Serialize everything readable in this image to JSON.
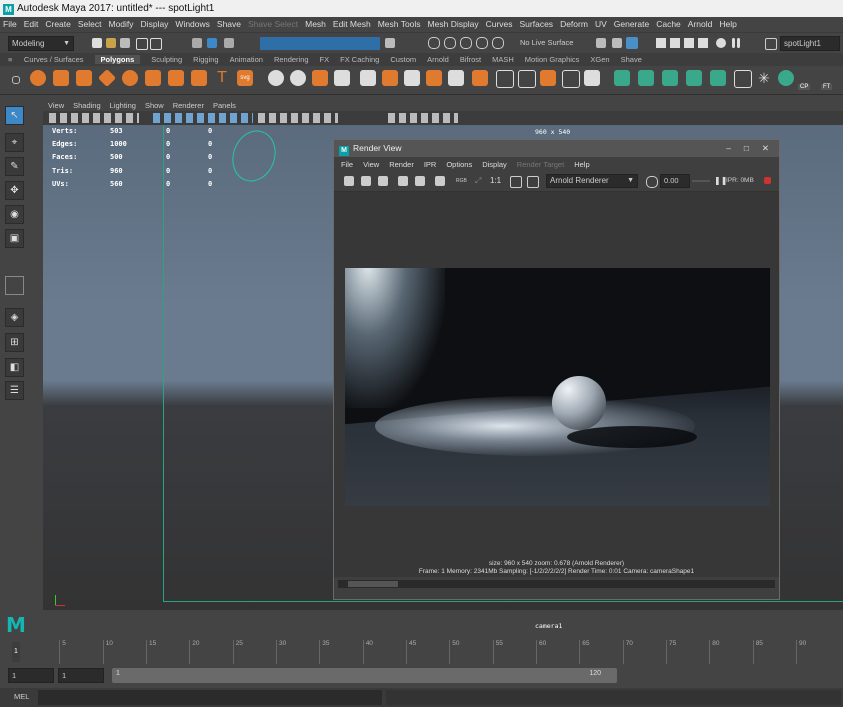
{
  "window": {
    "title": "Autodesk Maya 2017: untitled*   ---   spotLight1",
    "logo": "M"
  },
  "menubar": {
    "items": [
      "File",
      "Edit",
      "Create",
      "Select",
      "Modify",
      "Display",
      "Windows",
      "Shave",
      "Mesh",
      "Edit Mesh",
      "Mesh Tools",
      "Mesh Display",
      "Curves",
      "Surfaces",
      "Deform",
      "UV",
      "Generate",
      "Cache",
      "Arnold",
      "Help"
    ],
    "disabled_item": "Shave Select"
  },
  "statusline": {
    "mode": "Modeling",
    "live_surface": "No Live Surface",
    "selected_object": "spotLight1"
  },
  "shelf_tabs": {
    "items": [
      "Curves / Surfaces",
      "Polygons",
      "Sculpting",
      "Rigging",
      "Animation",
      "Rendering",
      "FX",
      "FX Caching",
      "Custom",
      "Arnold",
      "Bifrost",
      "MASH",
      "Motion Graphics",
      "XGen",
      "Shave"
    ],
    "active": "Polygons"
  },
  "shelf": {
    "cp_label": "CP",
    "ft_label": "FT"
  },
  "viewport": {
    "menu": [
      "View",
      "Shading",
      "Lighting",
      "Show",
      "Renderer",
      "Panels"
    ],
    "resolution_label": "960 x 540",
    "camera_label": "camera1",
    "hud": {
      "labels": [
        "Verts:",
        "Edges:",
        "Faces:",
        "Tris:",
        "UVs:"
      ],
      "values": [
        "503",
        "1000",
        "500",
        "960",
        "560"
      ],
      "col2": [
        "0",
        "0",
        "0",
        "0",
        "0"
      ],
      "col3": [
        "0",
        "0",
        "0",
        "0",
        "0"
      ]
    }
  },
  "render_view": {
    "title": "Render View",
    "menu": [
      "File",
      "View",
      "Render",
      "IPR",
      "Options",
      "Display",
      "Help"
    ],
    "disabled_menu": "Render Target",
    "ratio_label": "1:1",
    "renderer": "Arnold Renderer",
    "exposure": "0.00",
    "ipr_label": "IPR: 0MB",
    "info_line1": "size: 960 x 540  zoom: 0.678     (Arnold Renderer)",
    "info_line2": "Frame: 1    Memory: 2341Mb    Sampling: [-1/2/2/2/2/2]    Render Time: 0:01    Camera: cameraShape1"
  },
  "timeline": {
    "ticks": [
      "5",
      "10",
      "15",
      "20",
      "25",
      "30",
      "35",
      "40",
      "45",
      "50",
      "55",
      "60",
      "65",
      "70",
      "75",
      "80",
      "85",
      "90"
    ],
    "current_frame": "1"
  },
  "range": {
    "start": "1",
    "inner_start": "1",
    "slider_start": "1",
    "slider_end": "120"
  },
  "cmdline": {
    "label": "MEL"
  }
}
